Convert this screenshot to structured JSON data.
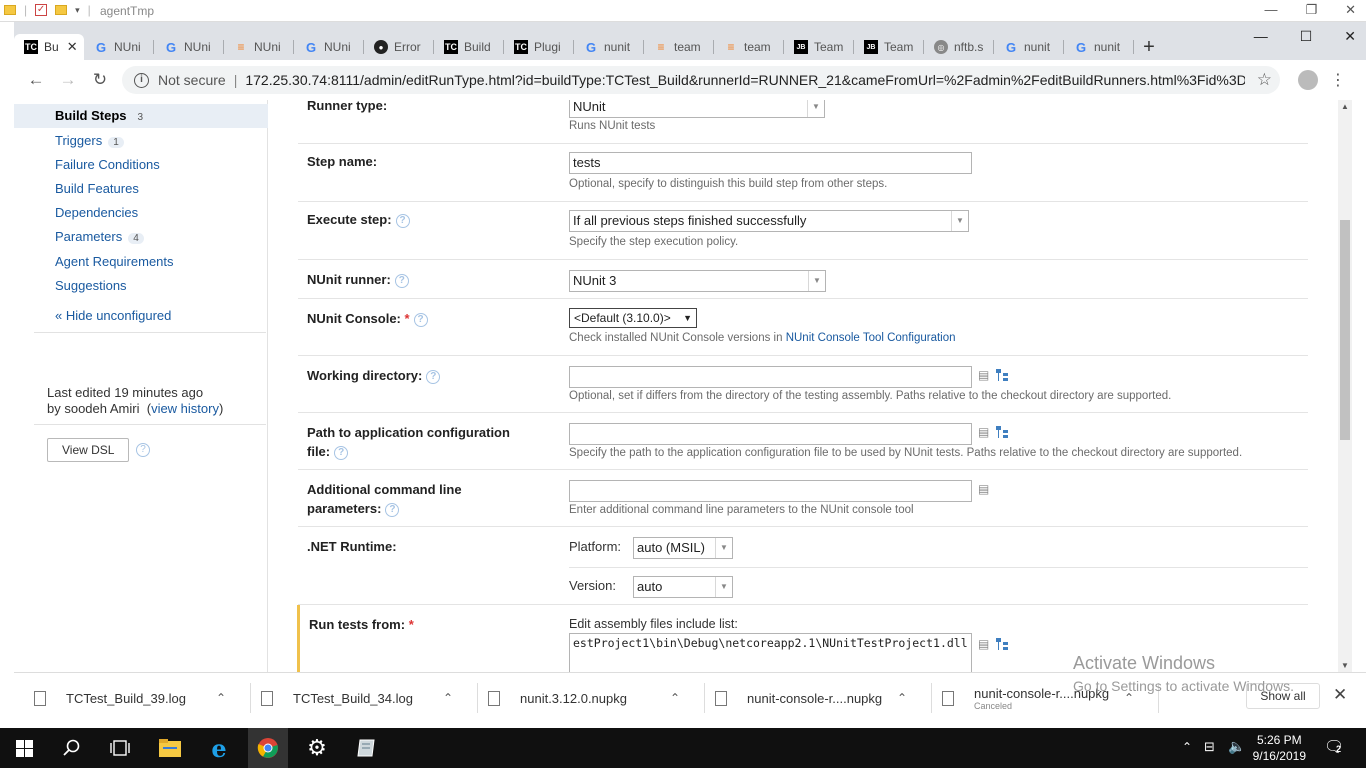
{
  "explorer": {
    "title": "agentTmp"
  },
  "browser": {
    "tabs": [
      {
        "icon": "TC",
        "label": "Bu",
        "active": true
      },
      {
        "icon": "G",
        "label": "NUni"
      },
      {
        "icon": "G",
        "label": "NUni"
      },
      {
        "icon": "SO",
        "label": "NUni"
      },
      {
        "icon": "G",
        "label": "NUni"
      },
      {
        "icon": "GH",
        "label": "Error"
      },
      {
        "icon": "TC",
        "label": "Build"
      },
      {
        "icon": "TC",
        "label": "Plugi"
      },
      {
        "icon": "G",
        "label": "nunit"
      },
      {
        "icon": "SO",
        "label": "team"
      },
      {
        "icon": "SO",
        "label": "team"
      },
      {
        "icon": "JB",
        "label": "Team"
      },
      {
        "icon": "JB",
        "label": "Team"
      },
      {
        "icon": "GL",
        "label": "nftb.s"
      },
      {
        "icon": "G",
        "label": "nunit"
      },
      {
        "icon": "G",
        "label": "nunit"
      }
    ],
    "not_secure": "Not secure",
    "url": "172.25.30.74:8111/admin/editRunType.html?id=buildType:TCTest_Build&runnerId=RUNNER_21&cameFromUrl=%2Fadmin%2FeditBuildRunners.html%3Fid%3Db..."
  },
  "sidebar": {
    "items": [
      {
        "label": "Build Steps",
        "count": "3",
        "active": true
      },
      {
        "label": "Triggers",
        "count": "1"
      },
      {
        "label": "Failure Conditions"
      },
      {
        "label": "Build Features"
      },
      {
        "label": "Dependencies"
      },
      {
        "label": "Parameters",
        "count": "4"
      },
      {
        "label": "Agent Requirements"
      },
      {
        "label": "Suggestions"
      }
    ],
    "hide_unconfigured": "« Hide unconfigured",
    "last_edited_prefix": "Last edited ",
    "last_edited_time": "19 minutes ago",
    "last_edited_by": "by soodeh Amiri",
    "view_history": "view history",
    "view_dsl": "View DSL"
  },
  "form": {
    "runner_type": {
      "label": "Runner type:",
      "value": "NUnit",
      "hint": "Runs NUnit tests"
    },
    "step_name": {
      "label": "Step name:",
      "value": "tests",
      "hint": "Optional, specify to distinguish this build step from other steps."
    },
    "execute_step": {
      "label": "Execute step:",
      "value": "If all previous steps finished successfully",
      "hint": "Specify the step execution policy."
    },
    "nunit_runner": {
      "label": "NUnit runner:",
      "value": "NUnit 3"
    },
    "nunit_console": {
      "label": "NUnit Console:",
      "value": "<Default (3.10.0)>",
      "hint_prefix": "Check installed NUnit Console versions in ",
      "hint_link": "NUnit Console Tool Configuration"
    },
    "working_dir": {
      "label": "Working directory:",
      "value": "",
      "hint": "Optional, set if differs from the directory of the testing assembly. Paths relative to the checkout directory are supported."
    },
    "app_config": {
      "label_1": "Path to application configuration",
      "label_2": "file:",
      "value": "",
      "hint": "Specify the path to the application configuration file to be used by NUnit tests. Paths relative to the checkout directory are supported."
    },
    "cmd_params": {
      "label_1": "Additional command line",
      "label_2": "parameters:",
      "value": "",
      "hint": "Enter additional command line parameters to the NUnit console tool"
    },
    "net_runtime": {
      "label": ".NET Runtime:",
      "platform_label": "Platform:",
      "platform_value": "auto (MSIL)",
      "version_label": "Version:",
      "version_value": "auto"
    },
    "run_tests_from": {
      "label": "Run tests from:",
      "hint": "Edit assembly files include list:",
      "value": "estProject1\\bin\\Debug\\netcoreapp2.1\\NUnitTestProject1.dll"
    }
  },
  "downloads": [
    {
      "name": "TCTest_Build_39.log"
    },
    {
      "name": "TCTest_Build_34.log"
    },
    {
      "name": "nunit.3.12.0.nupkg"
    },
    {
      "name": "nunit-console-r....nupkg"
    },
    {
      "name": "nunit-console-r....nupkg",
      "status": "Canceled"
    }
  ],
  "show_all": "Show all",
  "watermark": {
    "line1": "Activate Windows",
    "line2": "Go to Settings to activate Windows."
  },
  "taskbar": {
    "time": "5:26 PM",
    "date": "9/16/2019",
    "notif_count": "2"
  }
}
